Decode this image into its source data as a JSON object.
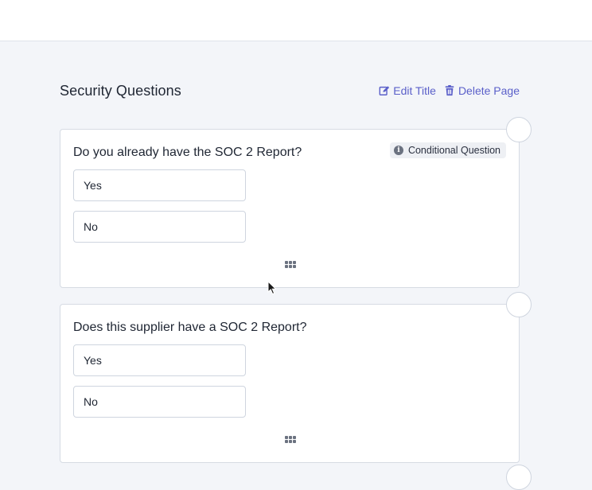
{
  "page": {
    "title": "Security Questions",
    "actions": {
      "edit_title": "Edit Title",
      "delete_page": "Delete Page"
    }
  },
  "questions": [
    {
      "text": "Do you already have the SOC 2 Report?",
      "badge": "Conditional Question",
      "options": [
        "Yes",
        "No"
      ]
    },
    {
      "text": "Does this supplier have a SOC 2 Report?",
      "options": [
        "Yes",
        "No"
      ]
    }
  ],
  "colors": {
    "accent": "#5a5fc9",
    "background": "#f3f5f9",
    "card_border": "#d6dbe3"
  },
  "icons": {
    "edit": "edit-icon",
    "delete": "trash-icon",
    "info": "info-icon",
    "drag": "drag-handle-icon"
  }
}
